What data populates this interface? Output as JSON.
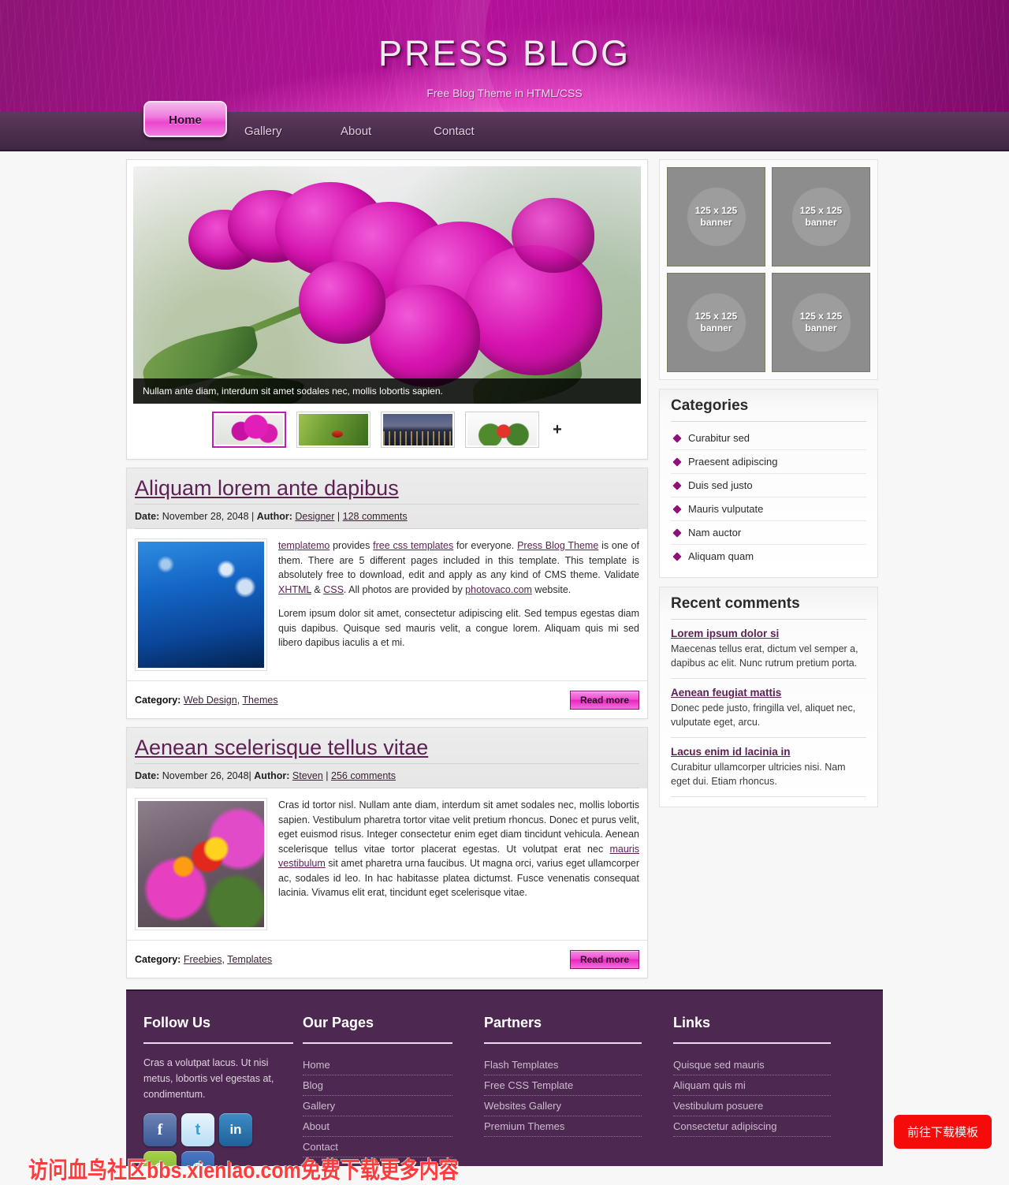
{
  "header": {
    "title": "PRESS BLOG",
    "tagline": "Free Blog Theme in HTML/CSS"
  },
  "nav": {
    "items": [
      {
        "label": "Home",
        "active": true
      },
      {
        "label": "Gallery",
        "active": false
      },
      {
        "label": "About",
        "active": false
      },
      {
        "label": "Contact",
        "active": false
      }
    ]
  },
  "slider": {
    "caption": "Nullam ante diam, interdum sit amet sodales nec, mollis lobortis sapien.",
    "thumbs": [
      {
        "name": "orchid-thumb",
        "active": true
      },
      {
        "name": "leaf-ladybug-thumb",
        "active": false
      },
      {
        "name": "city-night-thumb",
        "active": false
      },
      {
        "name": "strawberry-salad-thumb",
        "active": false
      }
    ],
    "more_symbol": "+"
  },
  "posts": [
    {
      "title": "Aliquam lorem ante dapibus",
      "date_label": "Date:",
      "date": "November 28, 2048",
      "author_label": "Author:",
      "author": "Designer",
      "comments": "128 comments",
      "separator": "|",
      "paragraphs": [
        "templatemo provides free css templates for everyone. Press Blog Theme is one of them. There are 5 different pages included in this template. This template is absolutely free to download, edit and apply as any kind of CMS theme. Validate XHTML & CSS. All photos are provided by photovaco.com website.",
        "Lorem ipsum dolor sit amet, consectetur adipiscing elit. Sed tempus egestas diam quis dapibus. Quisque sed mauris velit, a congue lorem. Aliquam quis mi sed libero dapibus iaculis a et mi."
      ],
      "category_label": "Category:",
      "categories": [
        "Web Design",
        "Themes"
      ],
      "read_more": "Read more"
    },
    {
      "title": "Aenean scelerisque tellus vitae",
      "date_label": "Date:",
      "date": "November 26, 2048",
      "author_label": "Author:",
      "author": "Steven",
      "comments": "256 comments",
      "separator": "|",
      "paragraphs": [
        "Cras id tortor nisl. Nullam ante diam, interdum sit amet sodales nec, mollis lobortis sapien. Vestibulum pharetra tortor vitae velit pretium rhoncus. Donec et purus velit, eget euismod risus. Integer consectetur enim eget diam tincidunt vehicula. Aenean scelerisque tellus vitae tortor placerat egestas. Ut volutpat erat nec mauris vestibulum sit amet pharetra urna faucibus. Ut magna orci, varius eget ullamcorper ac, sodales id leo. In hac habitasse platea dictumst. Fusce venenatis consequat lacinia. Vivamus elit erat, tincidunt eget scelerisque vitae."
      ],
      "category_label": "Category:",
      "categories": [
        "Freebies",
        "Templates"
      ],
      "read_more": "Read more"
    }
  ],
  "sidebar": {
    "banners": [
      {
        "line1": "125 x 125",
        "line2": "banner"
      },
      {
        "line1": "125 x 125",
        "line2": "banner"
      },
      {
        "line1": "125 x 125",
        "line2": "banner"
      },
      {
        "line1": "125 x 125",
        "line2": "banner"
      }
    ],
    "categories": {
      "title": "Categories",
      "items": [
        "Curabitur sed",
        "Praesent adipiscing",
        "Duis sed justo",
        "Mauris vulputate",
        "Nam auctor",
        "Aliquam quam"
      ]
    },
    "recent_comments": {
      "title": "Recent comments",
      "items": [
        {
          "title": "Lorem ipsum dolor si",
          "text": "Maecenas tellus erat, dictum vel semper a, dapibus ac elit. Nunc rutrum pretium porta."
        },
        {
          "title": "Aenean feugiat mattis",
          "text": "Donec pede justo, fringilla vel, aliquet nec, vulputate eget, arcu."
        },
        {
          "title": "Lacus enim id lacinia in",
          "text": "Curabitur ullamcorper ultricies nisi. Nam eget dui. Etiam rhoncus."
        }
      ]
    }
  },
  "footer": {
    "follow": {
      "title": "Follow Us",
      "text": "Cras a volutpat lacus. Ut nisi metus, lobortis vel egestas at, condimentum.",
      "socials": [
        "facebook-icon",
        "twitter-icon",
        "linkedin-icon",
        "rss-icon",
        "dribbble-icon"
      ],
      "social_glyphs": [
        "f",
        "t",
        "in",
        "e",
        "d"
      ]
    },
    "pages": {
      "title": "Our Pages",
      "items": [
        "Home",
        "Blog",
        "Gallery",
        "About",
        "Contact"
      ]
    },
    "partners": {
      "title": "Partners",
      "items": [
        "Flash Templates",
        "Free CSS Template",
        "Websites Gallery",
        "Premium Themes"
      ]
    },
    "links": {
      "title": "Links",
      "items": [
        "Quisque sed mauris",
        "Aliquam quis mi",
        "Vestibulum posuere",
        "Consectetur adipiscing"
      ]
    }
  },
  "overlay": {
    "watermark": "访问血鸟社区bbs.xienlao.com免费下载更多内容",
    "download_button": "前往下载模板"
  },
  "colors": {
    "brand_magenta": "#b5109a",
    "nav_purple": "#4c2f4e",
    "footer_purple": "#4d2850",
    "link_purple": "#5d2154",
    "accent_pink": "#ec46ce",
    "watermark_red": "#ff3b3b",
    "float_button_red": "#f60b0b"
  }
}
